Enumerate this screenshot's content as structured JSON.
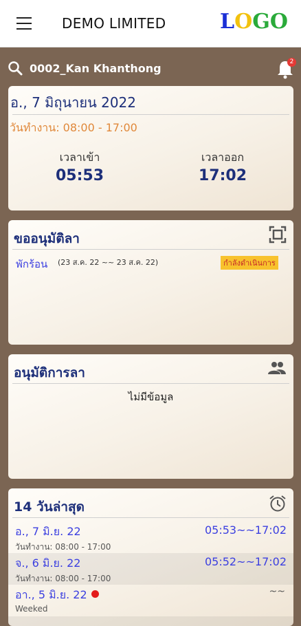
{
  "header": {
    "title": "DEMO LIMITED",
    "logo_letters": [
      "L",
      "O",
      "G",
      "O"
    ],
    "logo_colors": [
      "#1a2fd6",
      "#f2c20f",
      "#2aaa3a",
      "#2aaa3a"
    ]
  },
  "search": {
    "employee": "0002_Kan Khanthong",
    "notification_count": "2"
  },
  "today": {
    "date": "อ., 7 มิถุนายน 2022",
    "work_hours": "วันทำงาน: 08:00 - 17:00",
    "checkin_label": "เวลาเข้า",
    "checkin_time": "05:53",
    "checkout_label": "เวลาออก",
    "checkout_time": "17:02"
  },
  "leave_request": {
    "title": "ขออนุมัติลา",
    "item": {
      "type": "พักร้อน",
      "dates": "(23 ส.ค. 22 ~~ 23 ส.ค. 22)",
      "status": "กำลังดำเนินการ"
    }
  },
  "leave_approval": {
    "title": "อนุมัติการลา",
    "empty": "ไม่มีข้อมูล"
  },
  "recent": {
    "title": "14 วันล่าสุด",
    "rows": [
      {
        "date": "อ., 7 มิ.ย. 22",
        "sub": "วันทำงาน: 08:00 - 17:00",
        "time": "05:53~~17:02"
      },
      {
        "date": "จ., 6 มิ.ย. 22",
        "sub": "วันทำงาน: 08:00 - 17:00",
        "time": "05:52~~17:02"
      },
      {
        "date": "อา., 5 มิ.ย. 22",
        "sub": "Weeked",
        "time": "~~"
      }
    ]
  }
}
